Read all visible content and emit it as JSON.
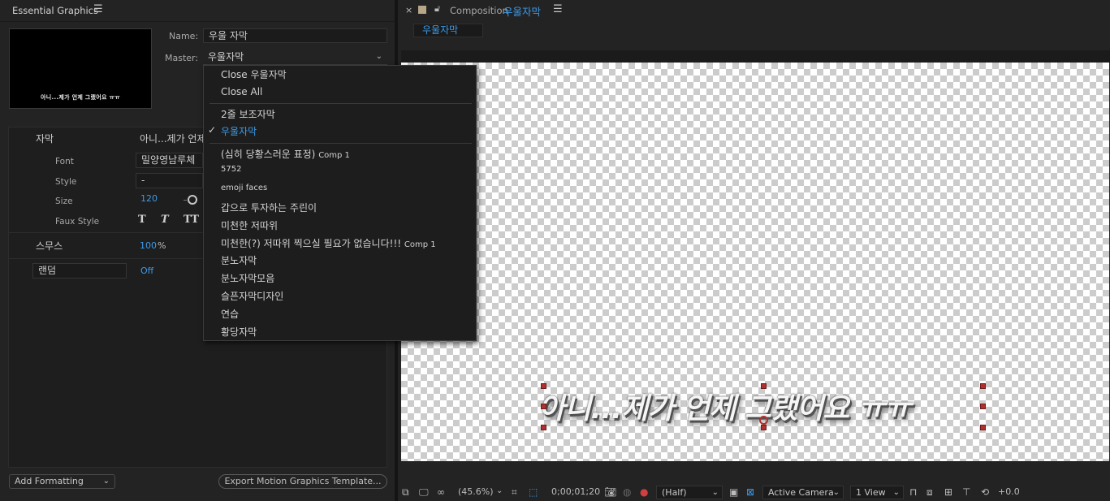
{
  "essential_graphics": {
    "panel_title": "Essential Graphics",
    "thumbnail_text": "아니...제가 언제 그랬어요 ㅠㅠ",
    "name_label": "Name:",
    "name_value": "우울 자막",
    "master_label": "Master:",
    "master_value": "우울자막",
    "properties": [
      {
        "label": "자막",
        "value": "아니...제가 언제"
      },
      {
        "label": "Font",
        "value": "밀양영남루체"
      },
      {
        "label": "Style",
        "value": "-"
      },
      {
        "label": "Size",
        "value": "120"
      },
      {
        "label": "Faux Style",
        "value": ""
      },
      {
        "label": "스무스",
        "value": "100",
        "unit": "%"
      },
      {
        "label": "랜덤",
        "value": "Off"
      }
    ],
    "faux_styles": [
      "T",
      "T",
      "TT"
    ],
    "add_formatting_label": "Add Formatting",
    "export_label": "Export Motion Graphics Template..."
  },
  "master_menu": {
    "items": [
      {
        "label": "Close 우울자막",
        "checked": false
      },
      {
        "label": "Close All",
        "checked": false
      },
      {
        "label": "2줄 보조자막",
        "checked": false
      },
      {
        "label": "우울자막",
        "checked": true,
        "highlight": true
      },
      {
        "label": "(심히 당황스러운 표정)",
        "suffix": "Comp 1",
        "checked": false
      },
      {
        "label": "5752",
        "checked": false
      },
      {
        "label": "emoji faces",
        "checked": false
      },
      {
        "label": "갑으로 투자하는 주린이",
        "checked": false
      },
      {
        "label": "미천한 저따위",
        "checked": false
      },
      {
        "label": "미천한(?) 저따위 찍으실 필요가 없습니다!!!",
        "suffix": "Comp 1",
        "checked": false
      },
      {
        "label": "분노자막",
        "checked": false
      },
      {
        "label": "분노자막모음",
        "checked": false
      },
      {
        "label": "슬픈자막디자인",
        "checked": false
      },
      {
        "label": "연습",
        "checked": false
      },
      {
        "label": "황당자막",
        "checked": false
      }
    ]
  },
  "composition": {
    "panel_prefix": "Composition",
    "panel_name": "우울자막",
    "subtab": "우울자막",
    "subtitle_text": "아니...제가 언제 그랬어요 ㅠㅠ",
    "toolbar": {
      "zoom": "(45.6%)",
      "timecode": "0;00;01;20",
      "resolution": "(Half)",
      "camera": "Active Camera",
      "views": "1 View",
      "exposure": "+0.0"
    }
  },
  "colors": {
    "accent_blue": "#3d9ae8",
    "handle_red": "#b03030"
  }
}
